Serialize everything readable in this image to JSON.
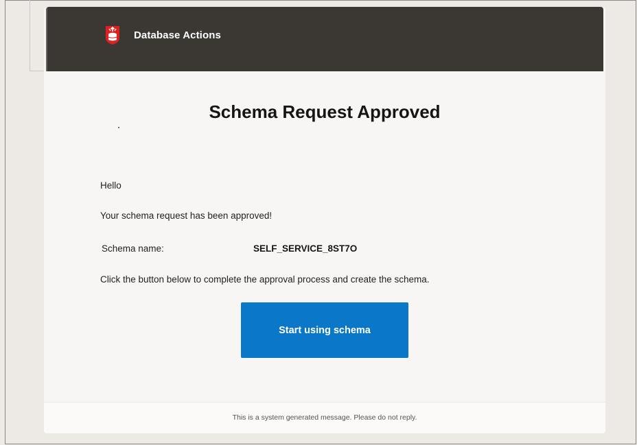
{
  "header": {
    "app_title": "Database Actions"
  },
  "message": {
    "title": "Schema Request Approved",
    "greeting": "Hello",
    "approved_text": "Your schema request has been approved!",
    "schema_label": "Schema name:",
    "schema_value": "SELF_SERVICE_8ST7O",
    "instruction": "Click the button below to complete the approval process and create the schema.",
    "button_label": "Start using schema"
  },
  "footer": {
    "note": "This is a system generated message. Please do not reply."
  },
  "colors": {
    "banner": "#3b3834",
    "logo": "#e02020",
    "button": "#0b77c9",
    "card": "#f7f6f5",
    "page": "#ede9e5"
  },
  "icons": {
    "logo": "database-actions-shield-icon"
  }
}
